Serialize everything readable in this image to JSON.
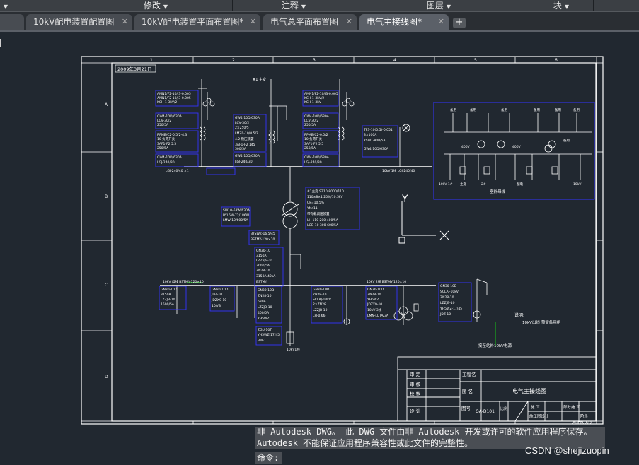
{
  "ribbon": {
    "items": [
      {
        "label": "修改"
      },
      {
        "label": "注释"
      },
      {
        "label": "图层"
      },
      {
        "label": "块"
      }
    ]
  },
  "tabs": [
    {
      "label": "10kV配电装置配置图",
      "active": false
    },
    {
      "label": "10kV配电装置平面布置图*",
      "active": false
    },
    {
      "label": "电气总平面布置图",
      "active": false
    },
    {
      "label": "电气主接线图*",
      "active": true
    }
  ],
  "drawing": {
    "date": "2009年3月21日",
    "col_marks": [
      "1",
      "2",
      "3",
      "4",
      "5",
      "6"
    ],
    "row_marks": [
      "A",
      "B",
      "C",
      "D"
    ],
    "title_block": {
      "design_name_label": "工程名",
      "drawing_name_label": "图 名",
      "drawing_name": "电气主接线图",
      "drawing_no_label": "图号",
      "drawing_no": "QA-D101",
      "scale_label": "比例",
      "approve": "审 定",
      "review": "审 核",
      "check": "校 核",
      "design": "设 计",
      "stage1": "施 工",
      "stage2": "部分施 工",
      "project": "施工图设计",
      "stage_label": "阶段",
      "autocad": "AutoCAD"
    },
    "ucs": {
      "x": "X",
      "y": "Y"
    },
    "labels": {
      "transformer_note": "#1 主变",
      "note_title": "说明:",
      "note_body": "10kV出线 预留备用柜",
      "cable_note": "接至站外10kV电源",
      "aux_title": "室外母线"
    }
  },
  "messages": {
    "line1": "非 Autodesk DWG。 此 DWG 文件由非 Autodesk 开发或许可的软件应用程序保存。",
    "line2": "Autodesk 不能保证应用程序兼容性或此文件的完整性。",
    "command_label": "命令:"
  },
  "watermark": "CSDN @shejizuopin",
  "colors": {
    "background": "#212830",
    "ribbon": "#3b3f44",
    "drawing_line": "#ffffff",
    "drawing_blue": "#2a2aff",
    "highlight_green": "#18c018"
  }
}
